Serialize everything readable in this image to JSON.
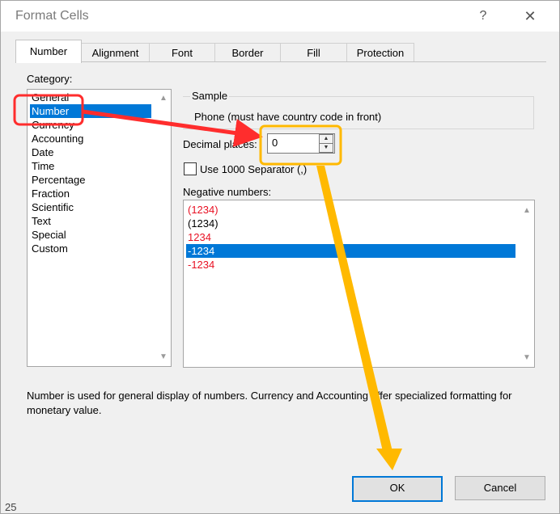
{
  "dialog": {
    "title": "Format Cells",
    "help_glyph": "?",
    "close_glyph": "✕"
  },
  "tabs": [
    {
      "label": "Number",
      "active": true
    },
    {
      "label": "Alignment"
    },
    {
      "label": "Font"
    },
    {
      "label": "Border"
    },
    {
      "label": "Fill"
    },
    {
      "label": "Protection"
    }
  ],
  "category": {
    "label": "Category:",
    "items": [
      "General",
      "Number",
      "Currency",
      "Accounting",
      "Date",
      "Time",
      "Percentage",
      "Fraction",
      "Scientific",
      "Text",
      "Special",
      "Custom"
    ],
    "selected": "Number"
  },
  "sample": {
    "label": "Sample",
    "value": "Phone (must have country code in front)"
  },
  "decimal_places": {
    "label": "Decimal places:",
    "value": "0"
  },
  "separator": {
    "label": "Use 1000 Separator (,)",
    "checked": false
  },
  "negative_numbers": {
    "label": "Negative numbers:",
    "items": [
      {
        "text": "(1234)",
        "red": true
      },
      {
        "text": "(1234)",
        "red": false
      },
      {
        "text": "1234",
        "red": true
      },
      {
        "text": "-1234",
        "red": false,
        "selected": true
      },
      {
        "text": "-1234",
        "red": true
      }
    ]
  },
  "description": "Number is used for general display of numbers.  Currency and Accounting offer specialized formatting for monetary value.",
  "buttons": {
    "ok": "OK",
    "cancel": "Cancel"
  },
  "background_row_number": "25",
  "colors": {
    "selection": "#0078d7",
    "negative_red": "#e81123",
    "annotation_red": "#ff2d2d",
    "annotation_orange": "#ffb900"
  }
}
